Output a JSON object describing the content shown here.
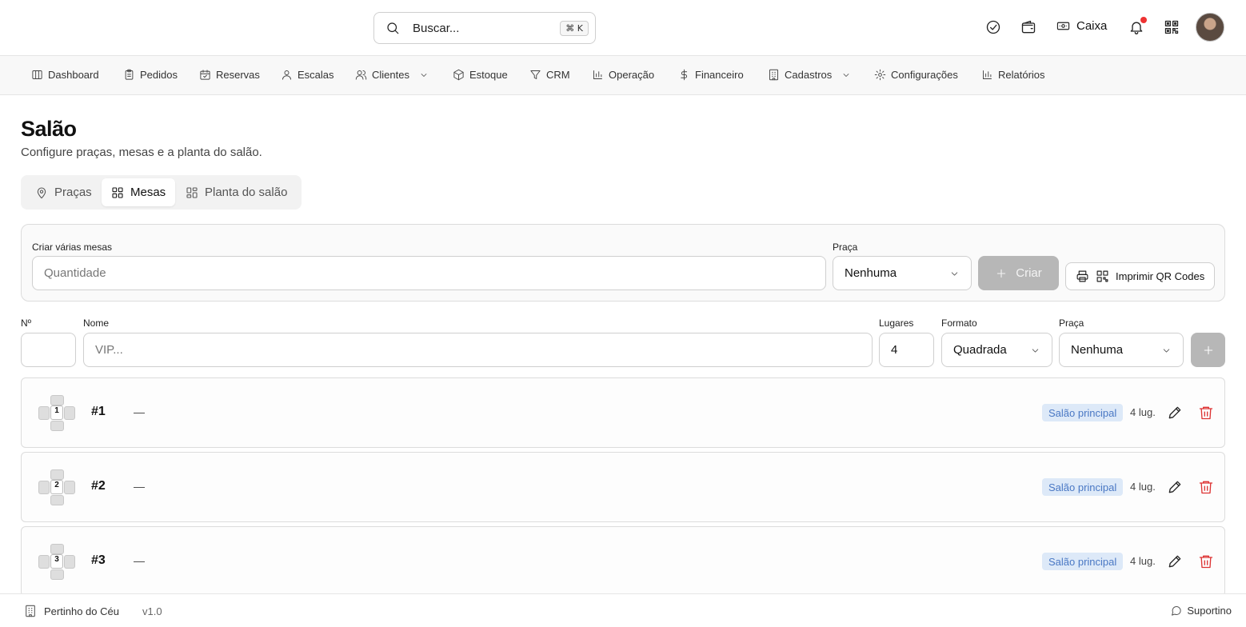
{
  "search": {
    "placeholder": "Buscar...",
    "shortcut": "⌘ K"
  },
  "topbar": {
    "caixa_label": "Caixa",
    "has_notification": true
  },
  "nav": {
    "items": [
      {
        "label": "Dashboard",
        "icon": "columns-icon"
      },
      {
        "label": "Pedidos",
        "icon": "clipboard-icon"
      },
      {
        "label": "Reservas",
        "icon": "calendar-check-icon"
      },
      {
        "label": "Escalas",
        "icon": "user-icon"
      },
      {
        "label": "Clientes",
        "icon": "users-icon",
        "dropdown": true
      },
      {
        "label": "Estoque",
        "icon": "package-icon"
      },
      {
        "label": "CRM",
        "icon": "filter-icon"
      },
      {
        "label": "Operação",
        "icon": "bar-chart-icon"
      },
      {
        "label": "Financeiro",
        "icon": "dollar-icon"
      },
      {
        "label": "Cadastros",
        "icon": "building-icon",
        "dropdown": true
      },
      {
        "label": "Configurações",
        "icon": "gear-icon"
      },
      {
        "label": "Relatórios",
        "icon": "bar-chart-icon"
      }
    ]
  },
  "page": {
    "title": "Salão",
    "subtitle": "Configure praças, mesas e a planta do salão."
  },
  "tabs": [
    {
      "label": "Praças",
      "icon": "map-pin-icon",
      "active": false
    },
    {
      "label": "Mesas",
      "icon": "grid-icon",
      "active": true
    },
    {
      "label": "Planta do salão",
      "icon": "layout-icon",
      "active": false
    }
  ],
  "batch": {
    "label": "Criar várias mesas",
    "quantity_placeholder": "Quantidade",
    "praca_label": "Praça",
    "praca_value": "Nenhuma",
    "create_label": "Criar",
    "print_label": "Imprimir QR Codes"
  },
  "single": {
    "num_label": "Nº",
    "num_value": "",
    "name_label": "Nome",
    "name_placeholder": "VIP...",
    "seats_label": "Lugares",
    "seats_value": "4",
    "format_label": "Formato",
    "format_value": "Quadrada",
    "praca_label": "Praça",
    "praca_value": "Nenhuma"
  },
  "tables": [
    {
      "icon_num": "1",
      "number": "#1",
      "name": "—",
      "praca": "Salão principal",
      "seats": "4 lug."
    },
    {
      "icon_num": "2",
      "number": "#2",
      "name": "—",
      "praca": "Salão principal",
      "seats": "4 lug."
    },
    {
      "icon_num": "3",
      "number": "#3",
      "name": "—",
      "praca": "Salão principal",
      "seats": "4 lug."
    }
  ],
  "footer": {
    "brand": "Pertinho do Céu",
    "version": "v1.0",
    "support": "Suportino"
  },
  "colors": {
    "accent_badge_bg": "#dde9f8",
    "accent_badge_text": "#4a78c4",
    "delete": "#dd3333",
    "notification": "#ee3333"
  }
}
